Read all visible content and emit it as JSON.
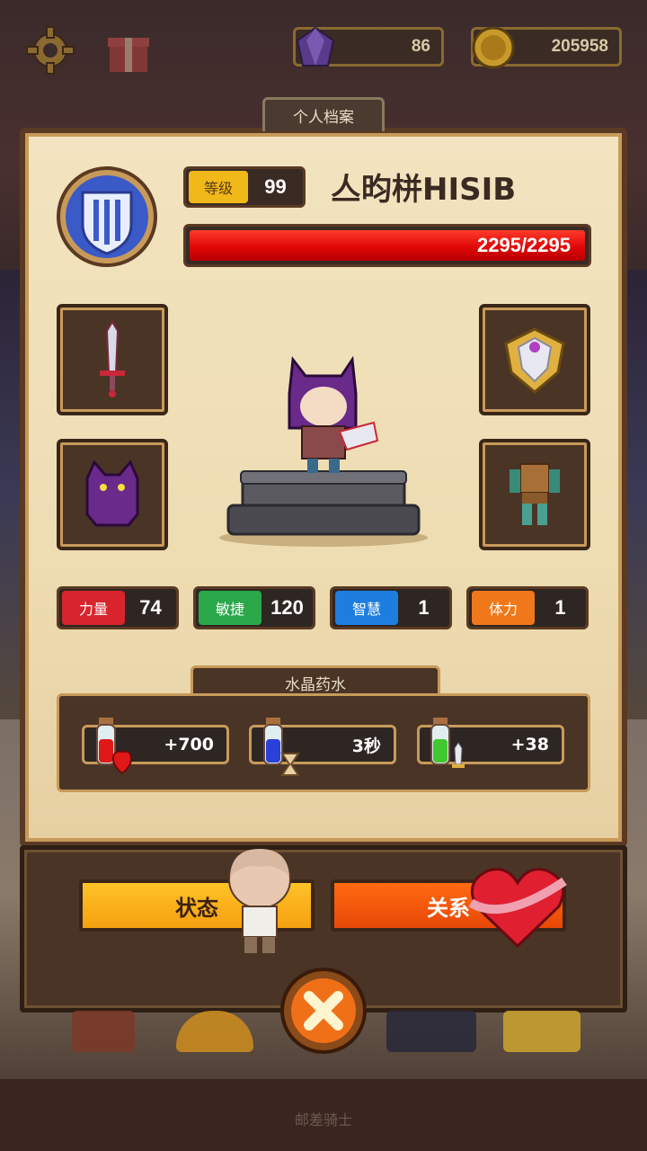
{
  "resources": {
    "gems": "86",
    "coins": "205958",
    "gem_icon": "purple-gem-icon",
    "coin_icon": "gold-coin-icon"
  },
  "tab_title": "个人档案",
  "profile": {
    "level_label": "等级",
    "level": "99",
    "name": "亼昀栟HISIB",
    "hp": "2295/2295",
    "hp_fraction": 1.0
  },
  "equipment": {
    "weapon": "sword-icon",
    "helmet": "cat-hood-icon",
    "shield": "shield-crest-icon",
    "armor": "armor-icon"
  },
  "stats": [
    {
      "label": "力量",
      "value": "74",
      "color": "#d8242c"
    },
    {
      "label": "敏捷",
      "value": "120",
      "color": "#2aa84a"
    },
    {
      "label": "智慧",
      "value": "1",
      "color": "#1e7ee0"
    },
    {
      "label": "体力",
      "value": "1",
      "color": "#f0781a"
    }
  ],
  "potions": {
    "title": "水晶药水",
    "items": [
      {
        "value": "+700",
        "icon": "red-potion-heart-icon"
      },
      {
        "value": "3秒",
        "icon": "blue-potion-hourglass-icon"
      },
      {
        "value": "+38",
        "icon": "green-potion-sword-icon"
      }
    ]
  },
  "buttons": {
    "status": "状态",
    "relation": "关系",
    "close": "close-icon"
  },
  "footer": "邮差骑士"
}
